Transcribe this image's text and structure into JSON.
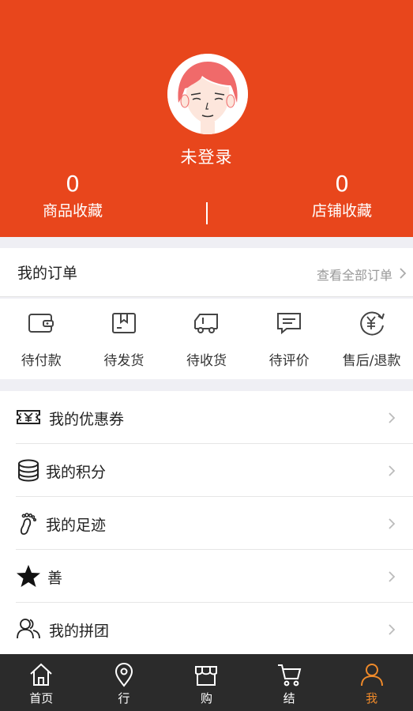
{
  "colors": {
    "primary": "#e8461c",
    "active_tab": "#ef8a2a",
    "tabbar_bg": "#2b2b2b"
  },
  "header": {
    "login_status": "未登录",
    "stats": [
      {
        "value": "0",
        "label": "商品收藏"
      },
      {
        "value": "0",
        "label": "店铺收藏"
      }
    ]
  },
  "orders": {
    "title": "我的订单",
    "view_all": "查看全部订单",
    "items": [
      {
        "label": "待付款",
        "icon": "wallet-icon"
      },
      {
        "label": "待发货",
        "icon": "package-icon"
      },
      {
        "label": "待收货",
        "icon": "truck-icon"
      },
      {
        "label": "待评价",
        "icon": "comment-icon"
      },
      {
        "label": "售后/退款",
        "icon": "refund-icon"
      }
    ]
  },
  "menu": [
    {
      "label": "我的优惠券",
      "icon": "coupon-icon"
    },
    {
      "label": "我的积分",
      "icon": "coins-icon"
    },
    {
      "label": "我的足迹",
      "icon": "footprint-icon"
    },
    {
      "label": "善",
      "icon": "star-icon"
    },
    {
      "label": "我的拼团",
      "icon": "group-icon"
    }
  ],
  "tabs": [
    {
      "label": "首页",
      "icon": "home-icon",
      "active": false
    },
    {
      "label": "行",
      "icon": "location-icon",
      "active": false
    },
    {
      "label": "购",
      "icon": "shop-icon",
      "active": false
    },
    {
      "label": "结",
      "icon": "cart-icon",
      "active": false
    },
    {
      "label": "我",
      "icon": "user-icon",
      "active": true
    }
  ]
}
